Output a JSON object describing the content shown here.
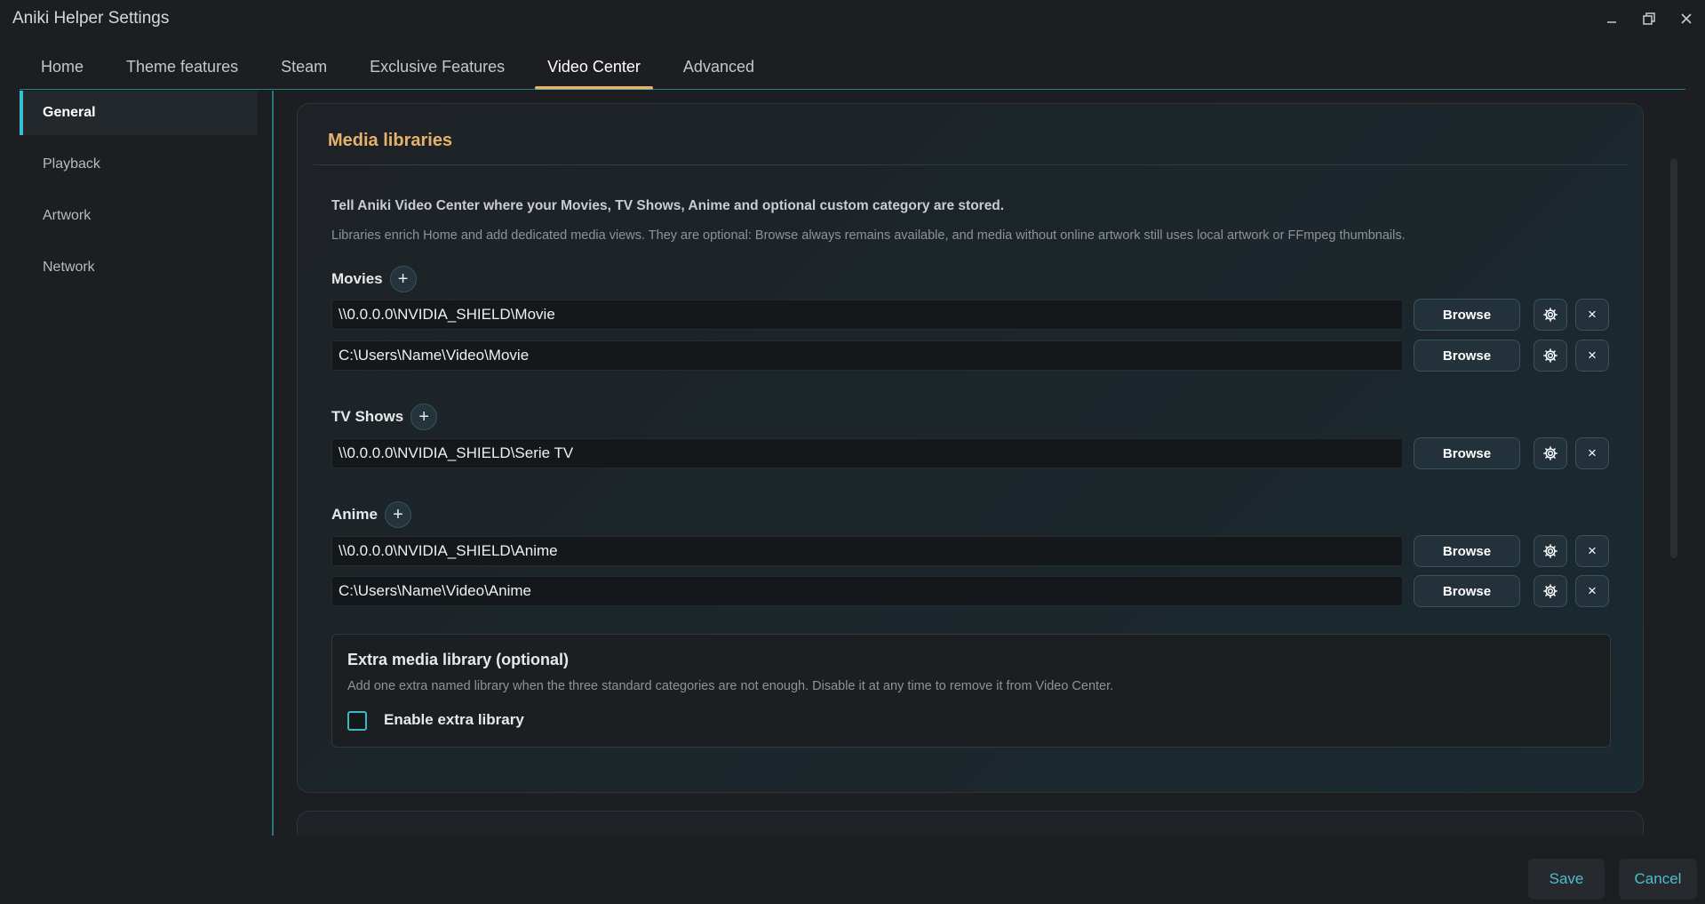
{
  "window": {
    "title": "Aniki Helper Settings",
    "minimize": "_",
    "maximize": "🗗",
    "close": "✕"
  },
  "tabs": [
    {
      "label": "Home"
    },
    {
      "label": "Theme features"
    },
    {
      "label": "Steam"
    },
    {
      "label": "Exclusive Features"
    },
    {
      "label": "Video Center",
      "active": true
    },
    {
      "label": "Advanced"
    }
  ],
  "sidebar": {
    "items": [
      {
        "label": "General",
        "active": true
      },
      {
        "label": "Playback"
      },
      {
        "label": "Artwork"
      },
      {
        "label": "Network"
      }
    ]
  },
  "card": {
    "title": "Media libraries",
    "intro": "Tell Aniki Video Center where your Movies, TV Shows, Anime and optional custom category are stored.",
    "hint": "Libraries enrich Home and add dedicated media views. They are optional: Browse always remains available, and media without online artwork still uses local artwork or FFmpeg thumbnails.",
    "add_symbol": "+",
    "browse_label": "Browse",
    "remove_symbol": "×",
    "categories": [
      {
        "label": "Movies",
        "paths": [
          "\\\\0.0.0.0\\NVIDIA_SHIELD\\Movie",
          "C:\\Users\\Name\\Video\\Movie"
        ]
      },
      {
        "label": "TV Shows",
        "paths": [
          "\\\\0.0.0.0\\NVIDIA_SHIELD\\Serie TV"
        ]
      },
      {
        "label": "Anime",
        "paths": [
          "\\\\0.0.0.0\\NVIDIA_SHIELD\\Anime",
          "C:\\Users\\Name\\Video\\Anime"
        ]
      }
    ],
    "extra": {
      "title": "Extra media library (optional)",
      "description": "Add one extra named library when the three standard categories are not enough. Disable it at any time to remove it from Video Center.",
      "checkbox_label": "Enable extra library",
      "checked": false
    }
  },
  "footer": {
    "save": "Save",
    "cancel": "Cancel"
  },
  "colors": {
    "accent": "#35c1d2",
    "tab_underline": "#e6b26a",
    "section_title": "#e6b26a",
    "footer_text": "#4fbfcc"
  }
}
